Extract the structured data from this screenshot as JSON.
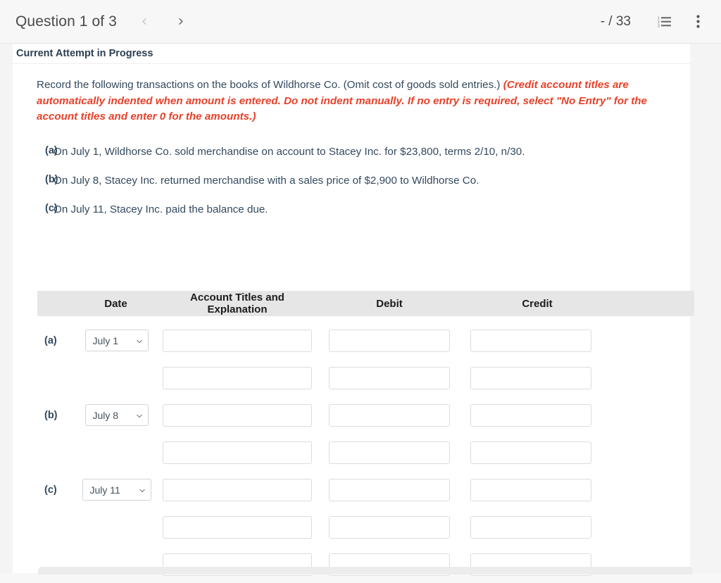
{
  "topbar": {
    "title": "Question 1 of 3",
    "prev_icon": "chevron-left-icon",
    "next_icon": "chevron-right-icon",
    "score": "- / 33",
    "list_icon": "ordered-list-icon",
    "menu_icon": "kebab-menu-icon"
  },
  "attempt": {
    "label": "Current Attempt in Progress"
  },
  "instructions": {
    "plain": "Record the following transactions on the books of Wildhorse Co. (Omit cost of goods sold entries.)",
    "red": "(Credit account titles are automatically indented when amount is entered. Do not indent manually. If no entry is required, select \"No Entry\" for the account titles and enter 0 for the amounts.)"
  },
  "transactions": [
    {
      "letter": "(a)",
      "text": "On July 1, Wildhorse Co. sold merchandise on account to Stacey Inc. for $23,800, terms 2/10, n/30."
    },
    {
      "letter": "(b)",
      "text": "On July 8, Stacey Inc. returned merchandise with a sales price of $2,900 to Wildhorse Co."
    },
    {
      "letter": "(c)",
      "text": "On July 11, Stacey Inc. paid the balance due."
    }
  ],
  "table": {
    "headers": {
      "letter": "",
      "date": "Date",
      "account": "Account Titles and Explanation",
      "debit": "Debit",
      "credit": "Credit"
    },
    "date_options": [
      "July 1",
      "July 8",
      "July 11"
    ],
    "rows": [
      {
        "letter": "(a)",
        "date": "July 1",
        "date_width": "narrow",
        "account": "",
        "debit": "",
        "credit": "",
        "account_placeholder": "",
        "debit_placeholder": "",
        "credit_placeholder": ""
      },
      {
        "letter": "",
        "date": "",
        "date_width": "narrow",
        "account": "",
        "debit": "",
        "credit": "",
        "account_placeholder": "",
        "debit_placeholder": "",
        "credit_placeholder": ""
      },
      {
        "letter": "(b)",
        "date": "July 8",
        "date_width": "narrow",
        "account": "",
        "debit": "",
        "credit": "",
        "account_placeholder": "",
        "debit_placeholder": "",
        "credit_placeholder": ""
      },
      {
        "letter": "",
        "date": "",
        "date_width": "narrow",
        "account": "",
        "debit": "",
        "credit": "",
        "account_placeholder": "",
        "debit_placeholder": "",
        "credit_placeholder": ""
      },
      {
        "letter": "(c)",
        "date": "July 11",
        "date_width": "wide",
        "account": "",
        "debit": "",
        "credit": "",
        "account_placeholder": "",
        "debit_placeholder": "",
        "credit_placeholder": ""
      },
      {
        "letter": "",
        "date": "",
        "date_width": "narrow",
        "account": "",
        "debit": "",
        "credit": "",
        "account_placeholder": "",
        "debit_placeholder": "",
        "credit_placeholder": ""
      },
      {
        "letter": "",
        "date": "",
        "date_width": "narrow",
        "account": "",
        "debit": "",
        "credit": "",
        "account_placeholder": "",
        "debit_placeholder": "",
        "credit_placeholder": ""
      }
    ]
  },
  "colors": {
    "red_text": "#e8412a",
    "body_text": "#34495e",
    "header_band": "#e6e6e6",
    "page_bg": "#f4f4f4"
  }
}
